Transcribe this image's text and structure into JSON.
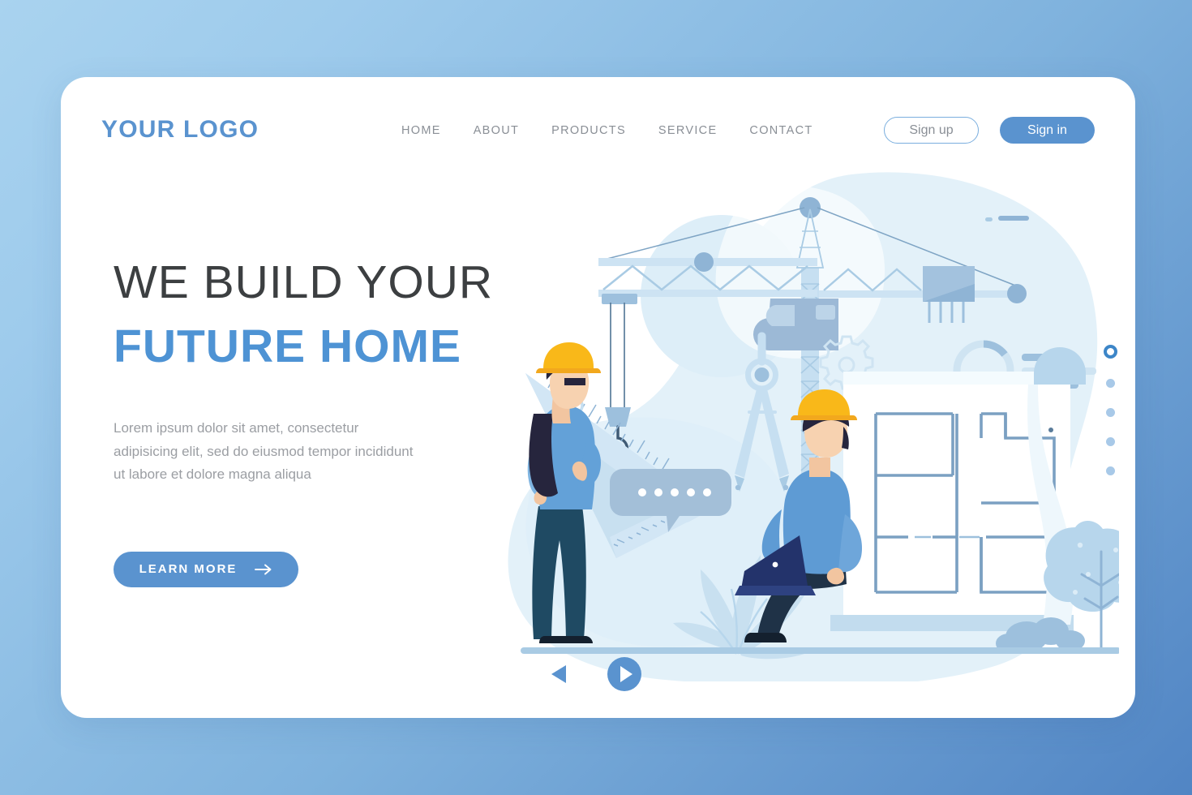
{
  "brand": {
    "logo_text": "YOUR LOGO",
    "accent_color": "#5a93cf",
    "headline_accent_color": "#4e93d4",
    "text_muted_color": "#9b9ea3"
  },
  "header": {
    "nav_items": [
      {
        "label": "HOME"
      },
      {
        "label": "ABOUT"
      },
      {
        "label": "PRODUCTS"
      },
      {
        "label": "SERVICE"
      },
      {
        "label": "CONTACT"
      }
    ],
    "signup_label": "Sign up",
    "signin_label": "Sign in"
  },
  "hero": {
    "headline_line1": "WE BUILD YOUR",
    "headline_line2": "FUTURE HOME",
    "paragraph": "Lorem ipsum dolor sit amet, consectetur adipisicing elit, sed do eiusmod tempor incididunt ut labore et dolore magna aliqua",
    "cta_label": "LEARN MORE",
    "cta_icon": "arrow-right-icon"
  },
  "carousel": {
    "prev_icon": "triangle-left-icon",
    "next_icon": "play-circle-icon",
    "dots": [
      {
        "active": true
      },
      {
        "active": false
      },
      {
        "active": false
      },
      {
        "active": false
      },
      {
        "active": false
      }
    ]
  },
  "illustration": {
    "name": "construction-scene-illustration",
    "elements": [
      "tower-crane",
      "crane-hook",
      "set-square-ruler",
      "drafting-compass",
      "gear-icon",
      "donut-chart",
      "blueprint-floorplan",
      "speech-bubble",
      "woman-engineer",
      "man-with-laptop",
      "plant",
      "tree",
      "bushes",
      "street-lamp",
      "plus-icon",
      "circle-outline-icon"
    ]
  }
}
